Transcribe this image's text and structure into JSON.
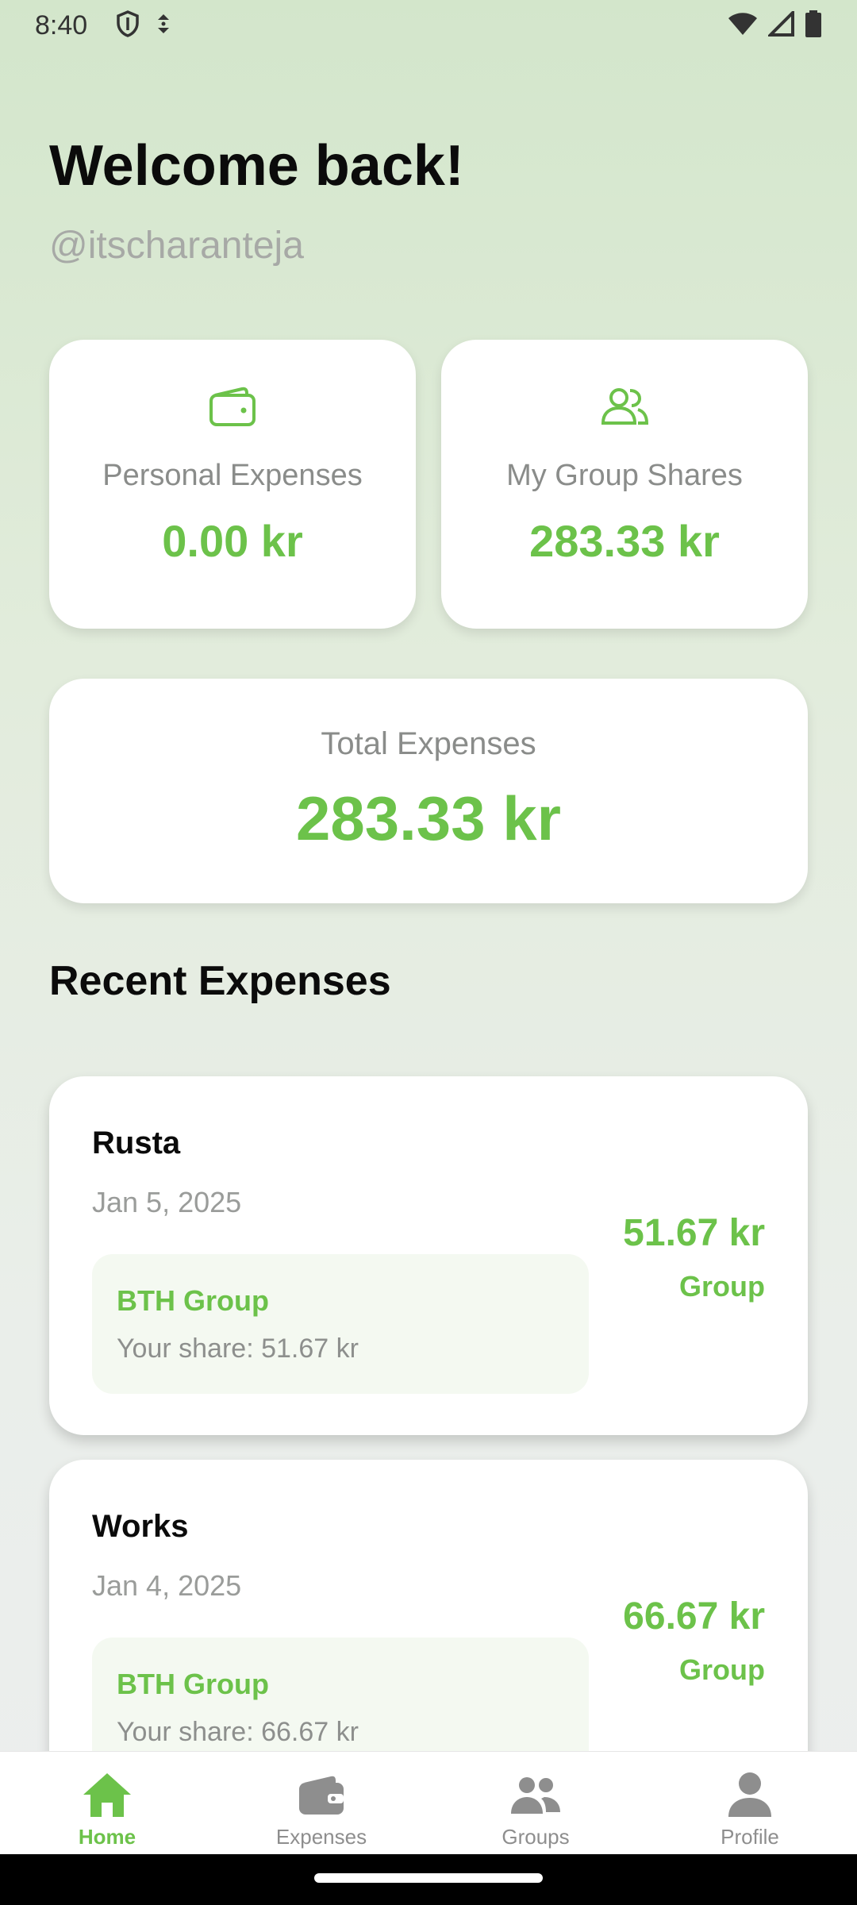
{
  "status_bar": {
    "time": "8:40"
  },
  "header": {
    "welcome": "Welcome back!",
    "username": "@itscharanteja"
  },
  "stats": {
    "personal": {
      "label": "Personal Expenses",
      "value": "0.00 kr",
      "icon": "wallet-icon"
    },
    "group_shares": {
      "label": "My Group Shares",
      "value": "283.33 kr",
      "icon": "people-icon"
    }
  },
  "total": {
    "label": "Total Expenses",
    "value": "283.33 kr"
  },
  "recent": {
    "title": "Recent Expenses",
    "items": [
      {
        "title": "Rusta",
        "date": "Jan 5, 2025",
        "group": "BTH Group",
        "share": "Your share: 51.67 kr",
        "amount": "51.67 kr",
        "tag": "Group"
      },
      {
        "title": "Works",
        "date": "Jan 4, 2025",
        "group": "BTH Group",
        "share": "Your share: 66.67 kr",
        "amount": "66.67 kr",
        "tag": "Group"
      }
    ]
  },
  "nav": {
    "items": [
      {
        "label": "Home",
        "icon": "home-icon",
        "active": true
      },
      {
        "label": "Expenses",
        "icon": "wallet-icon",
        "active": false
      },
      {
        "label": "Groups",
        "icon": "groups-icon",
        "active": false
      },
      {
        "label": "Profile",
        "icon": "profile-icon",
        "active": false
      }
    ]
  },
  "colors": {
    "accent": "#6cc24a",
    "muted": "#8e8e8e",
    "background_top": "#d3e6cb"
  }
}
